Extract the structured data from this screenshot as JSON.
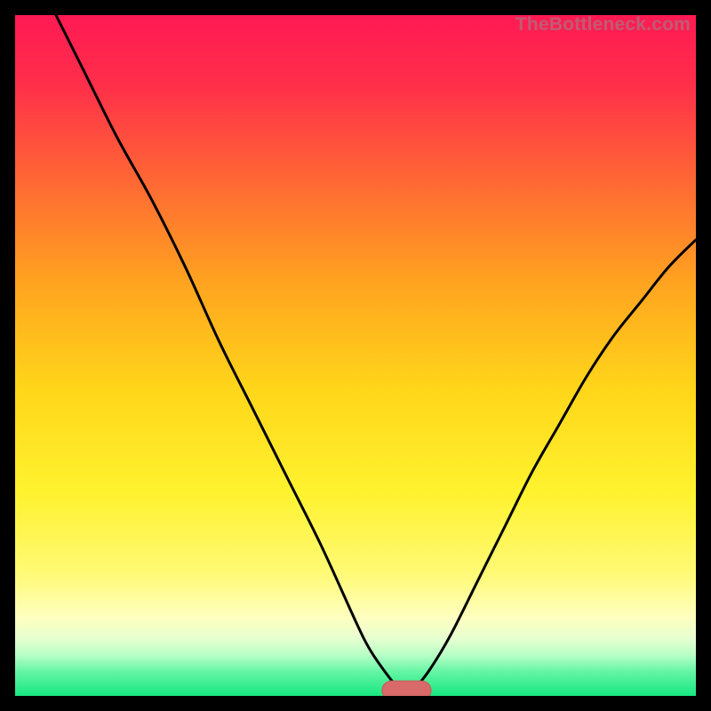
{
  "watermark": "TheBottleneck.com",
  "colors": {
    "background": "#000000",
    "gradient_stops": [
      {
        "offset": 0.0,
        "color": "#ff1a53"
      },
      {
        "offset": 0.1,
        "color": "#ff2e4a"
      },
      {
        "offset": 0.25,
        "color": "#ff6a33"
      },
      {
        "offset": 0.4,
        "color": "#ffa61f"
      },
      {
        "offset": 0.55,
        "color": "#ffd61a"
      },
      {
        "offset": 0.7,
        "color": "#fff22e"
      },
      {
        "offset": 0.82,
        "color": "#fffa75"
      },
      {
        "offset": 0.885,
        "color": "#ffffc0"
      },
      {
        "offset": 0.915,
        "color": "#e8ffd0"
      },
      {
        "offset": 0.94,
        "color": "#b7ffc6"
      },
      {
        "offset": 0.965,
        "color": "#63f5a3"
      },
      {
        "offset": 1.0,
        "color": "#18e880"
      }
    ],
    "curve": "#000000",
    "marker_fill": "#d86a6a",
    "marker_stroke": "#c55a5a"
  },
  "chart_data": {
    "type": "line",
    "title": "",
    "xlabel": "",
    "ylabel": "",
    "xlim": [
      0,
      100
    ],
    "ylim": [
      0,
      100
    ],
    "grid": false,
    "legend": false,
    "series": [
      {
        "name": "bottleneck-curve",
        "x": [
          6,
          10,
          15,
          20,
          25,
          30,
          35,
          40,
          45,
          50,
          52,
          54,
          56,
          57.5,
          59,
          61,
          64,
          68,
          72,
          76,
          80,
          84,
          88,
          92,
          96,
          100
        ],
        "y": [
          100,
          92,
          82,
          73,
          63,
          52,
          42,
          32,
          22,
          11,
          7,
          4,
          1.5,
          0.8,
          1.5,
          4,
          9,
          17,
          25,
          33,
          40,
          47,
          53,
          58,
          63,
          67
        ]
      }
    ],
    "marker": {
      "name": "optimum-marker",
      "x": 57.5,
      "y": 0.8,
      "rx": 3.6,
      "ry": 1.4
    }
  }
}
